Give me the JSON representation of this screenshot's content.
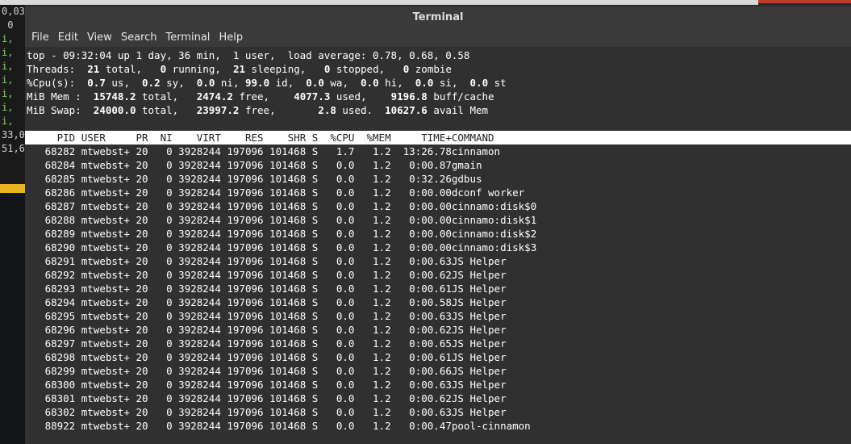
{
  "background": {
    "left_terminal_lines": [
      "0,03",
      " 0 ",
      "i,  ",
      "i,  ",
      "i,  ",
      "i,  ",
      "i,  ",
      "i,  ",
      "i,  ",
      "33,0",
      "51,6"
    ]
  },
  "window": {
    "title": "Terminal"
  },
  "menu": {
    "items": [
      "File",
      "Edit",
      "View",
      "Search",
      "Terminal",
      "Help"
    ]
  },
  "summary": {
    "line1": "top - 09:32:04 up 1 day, 36 min,  1 user,  load average: 0.78, 0.68, 0.58",
    "threads": {
      "label": "Threads:",
      "total": "21",
      "total_label": "total,",
      "running": "0",
      "running_label": "running,",
      "sleeping": "21",
      "sleeping_label": "sleeping,",
      "stopped": "0",
      "stopped_label": "stopped,",
      "zombie": "0",
      "zombie_label": "zombie"
    },
    "cpu": {
      "label": "%Cpu(s):",
      "us": "0.7",
      "us_label": "us,",
      "sy": "0.2",
      "sy_label": "sy,",
      "ni": "0.0",
      "ni_label": "ni,",
      "id": "99.0",
      "id_label": "id,",
      "wa": "0.0",
      "wa_label": "wa,",
      "hi": "0.0",
      "hi_label": "hi,",
      "si": "0.0",
      "si_label": "si,",
      "st": "0.0",
      "st_label": "st"
    },
    "mem": {
      "label": "MiB Mem :",
      "total": "15748.2",
      "total_label": "total,",
      "free": "2474.2",
      "free_label": "free,",
      "used": "4077.3",
      "used_label": "used,",
      "buff": "9196.8",
      "buff_label": "buff/cache"
    },
    "swap": {
      "label": "MiB Swap:",
      "total": "24000.0",
      "total_label": "total,",
      "free": "23997.2",
      "free_label": "free,",
      "used": "2.8",
      "used_label": "used.",
      "avail": "10627.6",
      "avail_label": "avail Mem"
    }
  },
  "columns": [
    "PID",
    "USER",
    "PR",
    "NI",
    "VIRT",
    "RES",
    "SHR",
    "S",
    "%CPU",
    "%MEM",
    "TIME+",
    "COMMAND"
  ],
  "processes": [
    [
      "68282",
      "mtwebst+",
      "20",
      "0",
      "3928244",
      "197096",
      "101468",
      "S",
      "1.7",
      "1.2",
      "13:26.78",
      "cinnamon"
    ],
    [
      "68284",
      "mtwebst+",
      "20",
      "0",
      "3928244",
      "197096",
      "101468",
      "S",
      "0.0",
      "1.2",
      "0:00.87",
      "gmain"
    ],
    [
      "68285",
      "mtwebst+",
      "20",
      "0",
      "3928244",
      "197096",
      "101468",
      "S",
      "0.0",
      "1.2",
      "0:32.26",
      "gdbus"
    ],
    [
      "68286",
      "mtwebst+",
      "20",
      "0",
      "3928244",
      "197096",
      "101468",
      "S",
      "0.0",
      "1.2",
      "0:00.00",
      "dconf worker"
    ],
    [
      "68287",
      "mtwebst+",
      "20",
      "0",
      "3928244",
      "197096",
      "101468",
      "S",
      "0.0",
      "1.2",
      "0:00.00",
      "cinnamo:disk$0"
    ],
    [
      "68288",
      "mtwebst+",
      "20",
      "0",
      "3928244",
      "197096",
      "101468",
      "S",
      "0.0",
      "1.2",
      "0:00.00",
      "cinnamo:disk$1"
    ],
    [
      "68289",
      "mtwebst+",
      "20",
      "0",
      "3928244",
      "197096",
      "101468",
      "S",
      "0.0",
      "1.2",
      "0:00.00",
      "cinnamo:disk$2"
    ],
    [
      "68290",
      "mtwebst+",
      "20",
      "0",
      "3928244",
      "197096",
      "101468",
      "S",
      "0.0",
      "1.2",
      "0:00.00",
      "cinnamo:disk$3"
    ],
    [
      "68291",
      "mtwebst+",
      "20",
      "0",
      "3928244",
      "197096",
      "101468",
      "S",
      "0.0",
      "1.2",
      "0:00.63",
      "JS Helper"
    ],
    [
      "68292",
      "mtwebst+",
      "20",
      "0",
      "3928244",
      "197096",
      "101468",
      "S",
      "0.0",
      "1.2",
      "0:00.62",
      "JS Helper"
    ],
    [
      "68293",
      "mtwebst+",
      "20",
      "0",
      "3928244",
      "197096",
      "101468",
      "S",
      "0.0",
      "1.2",
      "0:00.61",
      "JS Helper"
    ],
    [
      "68294",
      "mtwebst+",
      "20",
      "0",
      "3928244",
      "197096",
      "101468",
      "S",
      "0.0",
      "1.2",
      "0:00.58",
      "JS Helper"
    ],
    [
      "68295",
      "mtwebst+",
      "20",
      "0",
      "3928244",
      "197096",
      "101468",
      "S",
      "0.0",
      "1.2",
      "0:00.63",
      "JS Helper"
    ],
    [
      "68296",
      "mtwebst+",
      "20",
      "0",
      "3928244",
      "197096",
      "101468",
      "S",
      "0.0",
      "1.2",
      "0:00.62",
      "JS Helper"
    ],
    [
      "68297",
      "mtwebst+",
      "20",
      "0",
      "3928244",
      "197096",
      "101468",
      "S",
      "0.0",
      "1.2",
      "0:00.65",
      "JS Helper"
    ],
    [
      "68298",
      "mtwebst+",
      "20",
      "0",
      "3928244",
      "197096",
      "101468",
      "S",
      "0.0",
      "1.2",
      "0:00.61",
      "JS Helper"
    ],
    [
      "68299",
      "mtwebst+",
      "20",
      "0",
      "3928244",
      "197096",
      "101468",
      "S",
      "0.0",
      "1.2",
      "0:00.66",
      "JS Helper"
    ],
    [
      "68300",
      "mtwebst+",
      "20",
      "0",
      "3928244",
      "197096",
      "101468",
      "S",
      "0.0",
      "1.2",
      "0:00.63",
      "JS Helper"
    ],
    [
      "68301",
      "mtwebst+",
      "20",
      "0",
      "3928244",
      "197096",
      "101468",
      "S",
      "0.0",
      "1.2",
      "0:00.62",
      "JS Helper"
    ],
    [
      "68302",
      "mtwebst+",
      "20",
      "0",
      "3928244",
      "197096",
      "101468",
      "S",
      "0.0",
      "1.2",
      "0:00.63",
      "JS Helper"
    ],
    [
      "88922",
      "mtwebst+",
      "20",
      "0",
      "3928244",
      "197096",
      "101468",
      "S",
      "0.0",
      "1.2",
      "0:00.47",
      "pool-cinnamon"
    ]
  ],
  "colors": {
    "terminal_bg": "#303030",
    "text": "#ffffff",
    "header_bg": "#ffffff",
    "header_text": "#202020",
    "accent_yellow": "#e8b422"
  }
}
